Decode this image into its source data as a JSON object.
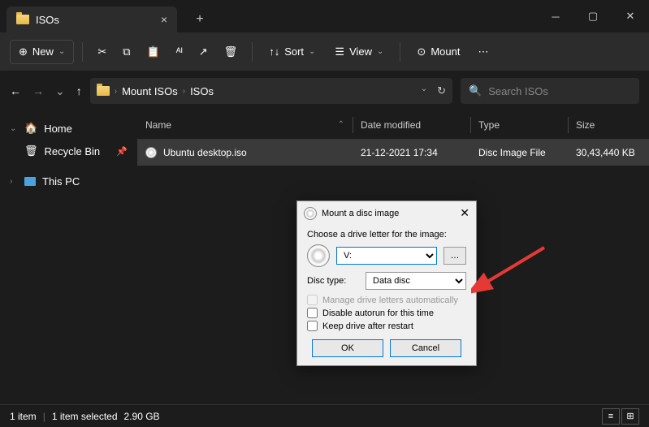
{
  "window": {
    "tab_title": "ISOs",
    "new_label": "New",
    "sort_label": "Sort",
    "view_label": "View",
    "mount_label": "Mount"
  },
  "breadcrumb": {
    "parts": [
      "Mount ISOs",
      "ISOs"
    ]
  },
  "search": {
    "placeholder": "Search ISOs"
  },
  "sidebar": {
    "home": "Home",
    "recycle": "Recycle Bin",
    "thispc": "This PC"
  },
  "columns": {
    "name": "Name",
    "date": "Date modified",
    "type": "Type",
    "size": "Size"
  },
  "rows": [
    {
      "name": "Ubuntu desktop.iso",
      "date": "21-12-2021 17:34",
      "type": "Disc Image File",
      "size": "30,43,440 KB"
    }
  ],
  "status": {
    "count": "1 item",
    "selected": "1 item selected",
    "size": "2.90 GB"
  },
  "dialog": {
    "title": "Mount a disc image",
    "choose_label": "Choose a drive letter for the image:",
    "drive_value": "V:",
    "disc_type_label": "Disc type:",
    "disc_type_value": "Data disc",
    "chk_manage": "Manage drive letters automatically",
    "chk_autorun": "Disable autorun for this time",
    "chk_keep": "Keep drive after restart",
    "ok": "OK",
    "cancel": "Cancel"
  }
}
